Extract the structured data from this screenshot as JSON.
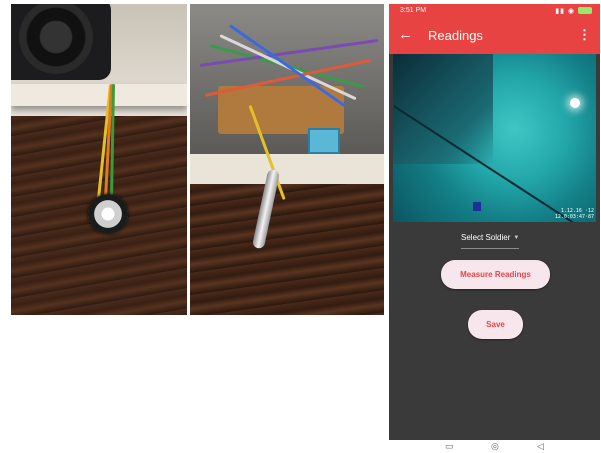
{
  "photos": [
    {
      "kind": "pulse-sensor-photo"
    },
    {
      "kind": "temperature-probe-photo"
    }
  ],
  "phone": {
    "status_bar": {
      "time": "3:51 PM",
      "icons": [
        "notification-icon",
        "signal-icon",
        "wifi-icon",
        "battery-icon"
      ]
    },
    "app_bar": {
      "title": "Readings",
      "back_icon": "←",
      "menu_icon": "⋮",
      "color": "#e84343"
    },
    "camera": {
      "timestamp": "1.12.16 ·12\n12.0:03:47·87"
    },
    "soldier_select": {
      "label": "Select Soldier"
    },
    "measure_button": {
      "label": "Measure Readings"
    },
    "save_button": {
      "label": "Save"
    },
    "colors": {
      "background": "#3a3a3a",
      "button_bg": "#f7e7ec",
      "button_text": "#e8434b"
    },
    "nav_bar": {
      "icons": [
        "recents-icon",
        "home-icon",
        "back-icon"
      ]
    }
  }
}
